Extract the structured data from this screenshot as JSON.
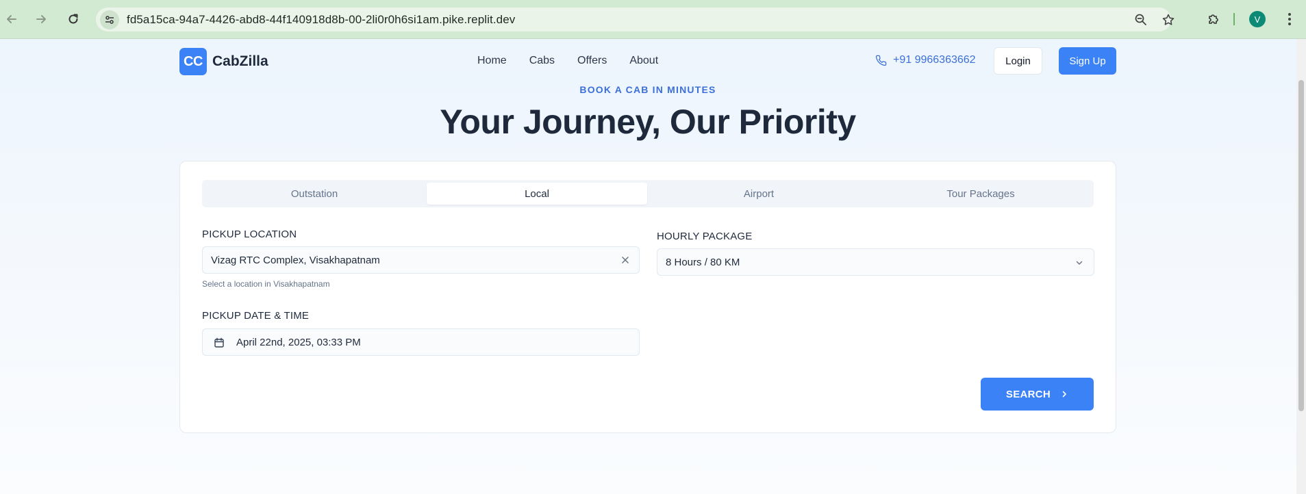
{
  "browser": {
    "url": "fd5a15ca-94a7-4426-abd8-44f140918d8b-00-2li0r0h6si1am.pike.replit.dev",
    "profile_initial": "V"
  },
  "header": {
    "logo_mark": "CC",
    "brand": "CabZilla",
    "nav": [
      "Home",
      "Cabs",
      "Offers",
      "About"
    ],
    "phone": "+91 9966363662",
    "login_label": "Login",
    "signup_label": "Sign Up"
  },
  "hero": {
    "eyebrow": "BOOK A CAB IN MINUTES",
    "title": "Your Journey, Our Priority"
  },
  "booking": {
    "tabs": [
      "Outstation",
      "Local",
      "Airport",
      "Tour Packages"
    ],
    "active_tab": "Local",
    "pickup_label": "PICKUP LOCATION",
    "pickup_value": "Vizag RTC Complex, Visakhapatnam",
    "pickup_helper": "Select a location in Visakhapatnam",
    "package_label": "HOURLY PACKAGE",
    "package_value": "8 Hours / 80 KM",
    "datetime_label": "PICKUP DATE & TIME",
    "datetime_value": "April 22nd, 2025, 03:33 PM",
    "search_label": "SEARCH"
  },
  "colors": {
    "accent": "#3b82f6",
    "link": "#3b6fd9",
    "heading": "#1e293b"
  }
}
